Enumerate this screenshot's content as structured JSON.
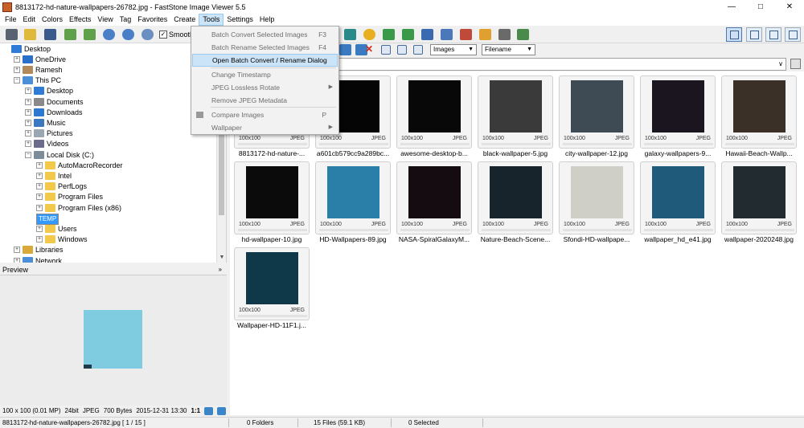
{
  "window": {
    "title": "8813172-hd-nature-wallpapers-26782.jpg  -  FastStone Image Viewer 5.5",
    "minimize_glyph": "—",
    "maximize_glyph": "□",
    "close_glyph": "✕"
  },
  "menubar": [
    "File",
    "Edit",
    "Colors",
    "Effects",
    "View",
    "Tag",
    "Favorites",
    "Create",
    "Tools",
    "Settings",
    "Help"
  ],
  "toolbar": {
    "smooth_label": "Smooth",
    "smooth_checked": "✓"
  },
  "tools_menu": [
    {
      "label": "Batch Convert Selected Images",
      "shortcut": "F3",
      "enabled": false
    },
    {
      "label": "Batch Rename Selected Images",
      "shortcut": "F4",
      "enabled": false
    },
    {
      "label": "Open Batch Convert / Rename Dialog",
      "shortcut": "",
      "enabled": true,
      "highlighted": true
    },
    {
      "label": "Change Timestamp",
      "shortcut": "",
      "enabled": false
    },
    {
      "label": "JPEG Lossless Rotate",
      "shortcut": "",
      "enabled": false,
      "submenu": true
    },
    {
      "label": "Remove JPEG Metadata",
      "shortcut": "",
      "enabled": false
    },
    {
      "label": "Compare Images",
      "shortcut": "P",
      "enabled": false
    },
    {
      "label": "Wallpaper",
      "shortcut": "",
      "enabled": false,
      "submenu": true
    }
  ],
  "filter": {
    "type_value": "Images",
    "sort_value": "Filename"
  },
  "address": {
    "value": "",
    "dropdown_glyph": "∨"
  },
  "tree": [
    {
      "label": "Desktop",
      "indent": 0,
      "icon": "desktop-icon",
      "color": "#2f7bd6",
      "expander": ""
    },
    {
      "label": "OneDrive",
      "indent": 1,
      "icon": "cloud-icon",
      "color": "#2a6fc9",
      "expander": "+"
    },
    {
      "label": "Ramesh",
      "indent": 1,
      "icon": "user-icon",
      "color": "#b08a5a",
      "expander": "+"
    },
    {
      "label": "This PC",
      "indent": 1,
      "icon": "computer-icon",
      "color": "#4a8fd8",
      "expander": "−"
    },
    {
      "label": "Desktop",
      "indent": 2,
      "icon": "desktop-icon",
      "color": "#2f7bd6",
      "expander": "+"
    },
    {
      "label": "Documents",
      "indent": 2,
      "icon": "documents-icon",
      "color": "#8a8a8a",
      "expander": "+"
    },
    {
      "label": "Downloads",
      "indent": 2,
      "icon": "downloads-icon",
      "color": "#2b79d0",
      "expander": "+"
    },
    {
      "label": "Music",
      "indent": 2,
      "icon": "music-icon",
      "color": "#3a78c2",
      "expander": "+"
    },
    {
      "label": "Pictures",
      "indent": 2,
      "icon": "pictures-icon",
      "color": "#9aa6b2",
      "expander": "+"
    },
    {
      "label": "Videos",
      "indent": 2,
      "icon": "videos-icon",
      "color": "#6b6b8a",
      "expander": "+"
    },
    {
      "label": "Local Disk (C:)",
      "indent": 2,
      "icon": "drive-icon",
      "color": "#7d8c99",
      "expander": "−"
    },
    {
      "label": "AutoMacroRecorder",
      "indent": 3,
      "icon": "folder-icon",
      "color": "#f3c94c",
      "expander": "+"
    },
    {
      "label": "Intel",
      "indent": 3,
      "icon": "folder-icon",
      "color": "#f3c94c",
      "expander": "+"
    },
    {
      "label": "PerfLogs",
      "indent": 3,
      "icon": "folder-icon",
      "color": "#f3c94c",
      "expander": "+"
    },
    {
      "label": "Program Files",
      "indent": 3,
      "icon": "folder-icon",
      "color": "#f3c94c",
      "expander": "+"
    },
    {
      "label": "Program Files (x86)",
      "indent": 3,
      "icon": "folder-icon",
      "color": "#f3c94c",
      "expander": "+"
    },
    {
      "label": "TEMP",
      "indent": 3,
      "icon": "folder-icon",
      "color": "#f3c94c",
      "expander": "",
      "selected": true
    },
    {
      "label": "Users",
      "indent": 3,
      "icon": "folder-icon",
      "color": "#f3c94c",
      "expander": "+"
    },
    {
      "label": "Windows",
      "indent": 3,
      "icon": "folder-icon",
      "color": "#f3c94c",
      "expander": "+"
    },
    {
      "label": "Libraries",
      "indent": 1,
      "icon": "libraries-icon",
      "color": "#d9a93a",
      "expander": "+"
    },
    {
      "label": "Network",
      "indent": 1,
      "icon": "network-icon",
      "color": "#4a8fd8",
      "expander": "+"
    }
  ],
  "preview": {
    "header": "Preview",
    "collapse_glyph": "»",
    "image_color": "#7fcbe0",
    "info": {
      "dims": "100 x 100 (0.01 MP)",
      "depth": "24bit",
      "format": "JPEG",
      "size": "700 Bytes",
      "date": "2015-12-31 13:30",
      "ratio": "1:1"
    }
  },
  "thumbnails": [
    {
      "name": "8813172-hd-nature-...",
      "dims": "100x100",
      "format": "JPEG",
      "color": "#101010"
    },
    {
      "name": "a601cb579cc9a289bc...",
      "dims": "100x100",
      "format": "JPEG",
      "color": "#050505"
    },
    {
      "name": "awesome-desktop-b...",
      "dims": "100x100",
      "format": "JPEG",
      "color": "#080808"
    },
    {
      "name": "black-wallpaper-5.jpg",
      "dims": "100x100",
      "format": "JPEG",
      "color": "#3a3a3a"
    },
    {
      "name": "city-wallpaper-12.jpg",
      "dims": "100x100",
      "format": "JPEG",
      "color": "#3e4a54"
    },
    {
      "name": "galaxy-wallpapers-9...",
      "dims": "100x100",
      "format": "JPEG",
      "color": "#1b1520"
    },
    {
      "name": "Hawaii-Beach-Wallp...",
      "dims": "100x100",
      "format": "JPEG",
      "color": "#3a3028"
    },
    {
      "name": "hd-wallpaper-10.jpg",
      "dims": "100x100",
      "format": "JPEG",
      "color": "#0b0b0b"
    },
    {
      "name": "HD-Wallpapers-89.jpg",
      "dims": "100x100",
      "format": "JPEG",
      "color": "#2a7fa8"
    },
    {
      "name": "NASA-SpiralGalaxyM...",
      "dims": "100x100",
      "format": "JPEG",
      "color": "#140c10"
    },
    {
      "name": "Nature-Beach-Scene...",
      "dims": "100x100",
      "format": "JPEG",
      "color": "#18242c"
    },
    {
      "name": "Sfondi-HD-wallpape...",
      "dims": "100x100",
      "format": "JPEG",
      "color": "#cfcfc8"
    },
    {
      "name": "wallpaper_hd_e41.jpg",
      "dims": "100x100",
      "format": "JPEG",
      "color": "#1f5a7a"
    },
    {
      "name": "wallpaper-2020248.jpg",
      "dims": "100x100",
      "format": "JPEG",
      "color": "#222c30"
    },
    {
      "name": "Wallpaper-HD-11F1.j...",
      "dims": "100x100",
      "format": "JPEG",
      "color": "#0f3848"
    }
  ],
  "statusbar": {
    "file": "8813172-hd-nature-wallpapers-26782.jpg [ 1 / 15 ]",
    "folders": "0 Folders",
    "files": "15 Files (59.1 KB)",
    "selected": "0 Selected"
  }
}
